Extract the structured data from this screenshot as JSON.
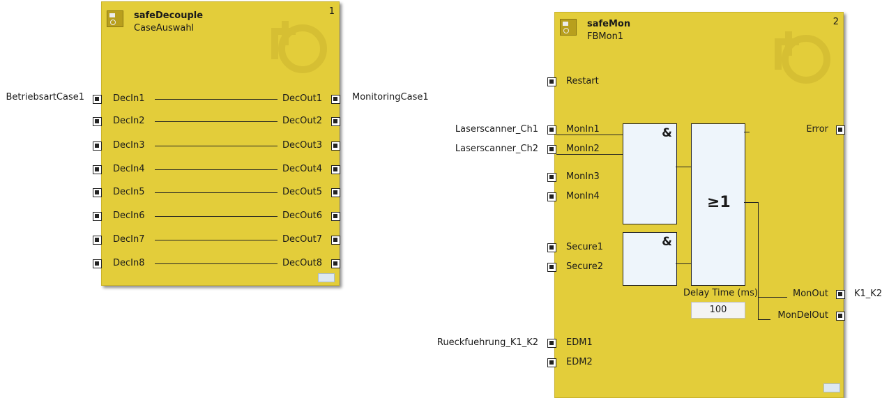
{
  "block1": {
    "type": "safeDecouple",
    "name": "CaseAuswahl",
    "number": "1",
    "inputs": [
      "DecIn1",
      "DecIn2",
      "DecIn3",
      "DecIn4",
      "DecIn5",
      "DecIn6",
      "DecIn7",
      "DecIn8"
    ],
    "outputs": [
      "DecOut1",
      "DecOut2",
      "DecOut3",
      "DecOut4",
      "DecOut5",
      "DecOut6",
      "DecOut7",
      "DecOut8"
    ],
    "external_in": "BetriebsartCase1",
    "external_out": "MonitoringCase1"
  },
  "block2": {
    "type": "safeMon",
    "name": "FBMon1",
    "number": "2",
    "inputs": {
      "restart": "Restart",
      "monin1": "MonIn1",
      "monin2": "MonIn2",
      "monin3": "MonIn3",
      "monin4": "MonIn4",
      "secure1": "Secure1",
      "secure2": "Secure2",
      "edm1": "EDM1",
      "edm2": "EDM2"
    },
    "outputs": {
      "error": "Error",
      "monout": "MonOut",
      "mondelout": "MonDelOut"
    },
    "gates": {
      "and1": "&",
      "and2": "&",
      "or": "≥1"
    },
    "delay_label": "Delay Time (ms)",
    "delay_value": "100",
    "external": {
      "ch1": "Laserscanner_Ch1",
      "ch2": "Laserscanner_Ch2",
      "edm": "Rueckfuehrung_K1_K2",
      "k1k2": "K1_K2"
    }
  },
  "colors": {
    "block": "#e3cd3a",
    "gate": "#eef5fb",
    "wire": "#222222"
  },
  "icons": {
    "block_icon": "function-block-icon",
    "watermark": "gear-watermark-icon",
    "port": "port-connector-icon"
  }
}
